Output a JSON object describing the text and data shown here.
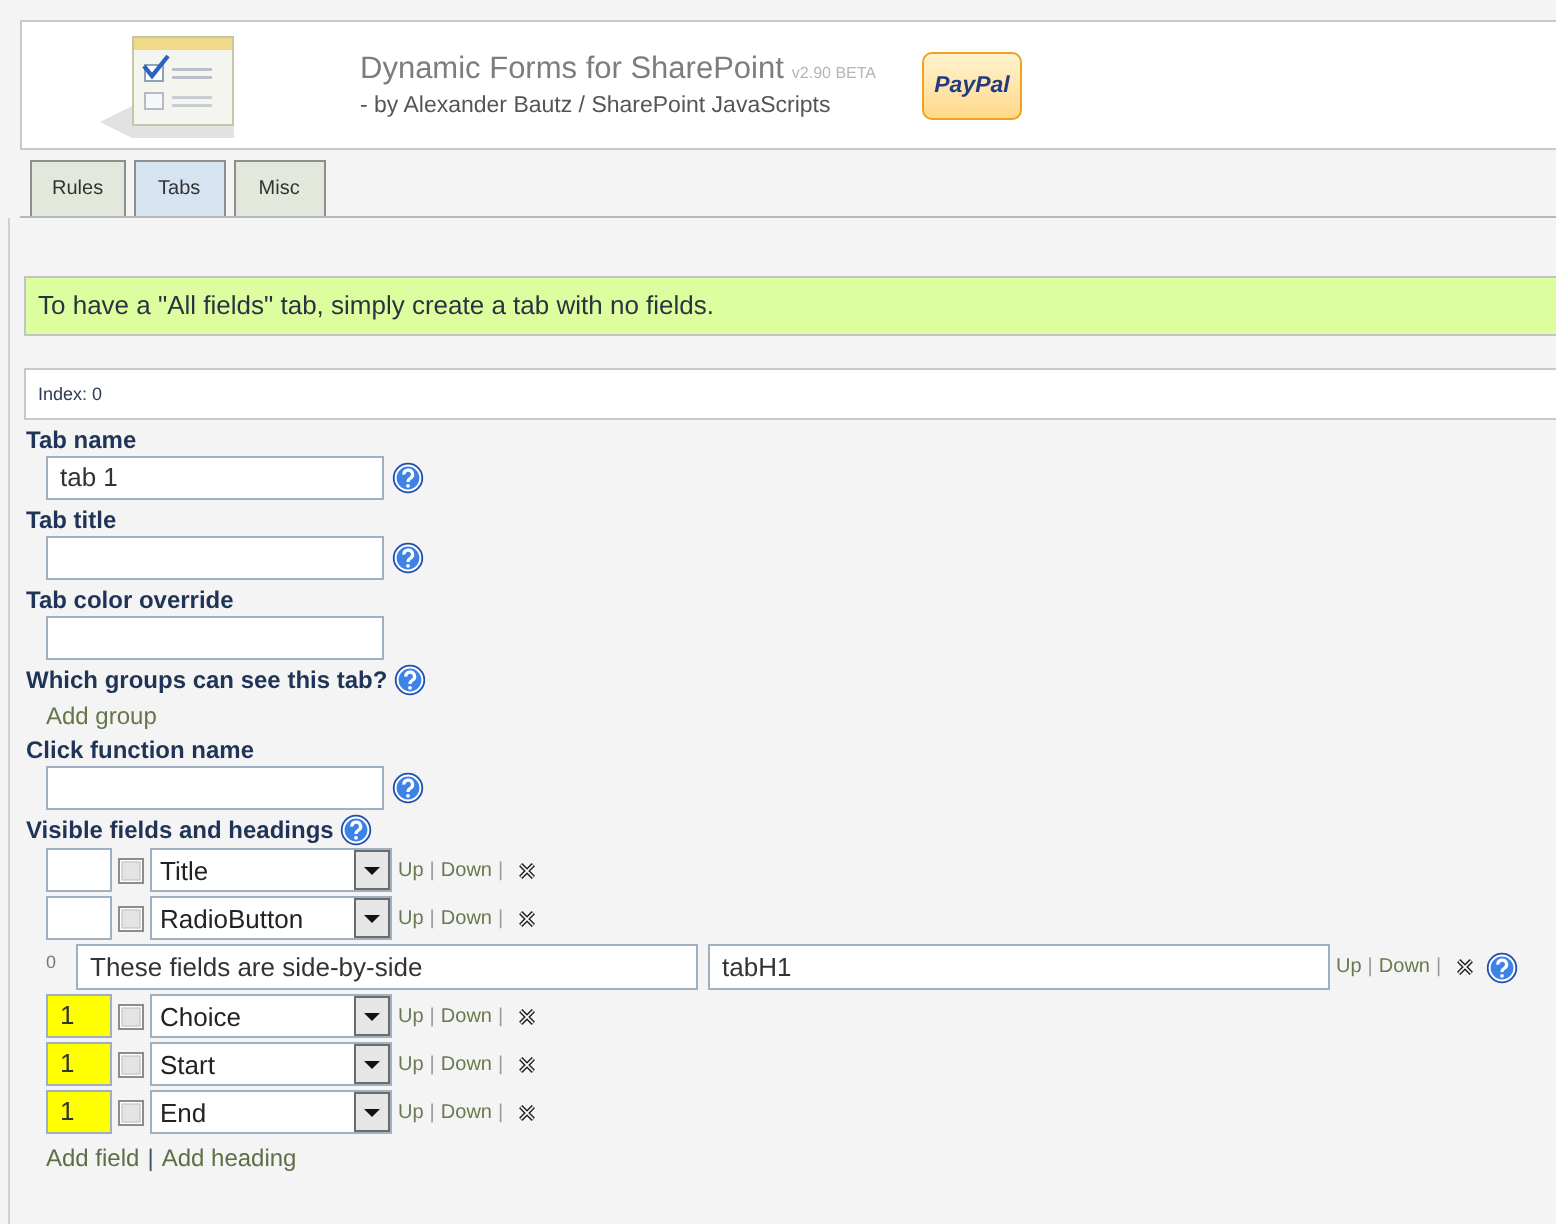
{
  "header": {
    "title": "Dynamic Forms for SharePoint",
    "version": "v2.90 BETA",
    "subtitle": "- by Alexander Bautz / SharePoint JavaScripts",
    "donate_button": "PayPal"
  },
  "tabs": [
    {
      "label": "Rules",
      "selected": false
    },
    {
      "label": "Tabs",
      "selected": true
    },
    {
      "label": "Misc",
      "selected": false
    }
  ],
  "notice": "To have a \"All fields\" tab, simply create a tab with no fields.",
  "index_label": "Index: 0",
  "form_fields": [
    {
      "kind": "input",
      "label": "Tab name",
      "value": "tab 1",
      "help": true
    },
    {
      "kind": "input",
      "label": "Tab title",
      "help": true
    },
    {
      "kind": "input",
      "label": "Tab color override"
    },
    {
      "kind": "link",
      "label": "Which groups can see this tab?",
      "link": "Add group",
      "help": true
    },
    {
      "kind": "input",
      "label": "Click function name",
      "help": true
    }
  ],
  "visible_fields": {
    "label": "Visible fields and headings",
    "help": true,
    "separator": "|",
    "rows": [
      {
        "kind": "field",
        "highlighted": false,
        "checked": false,
        "value": "Title",
        "actions": [
          "Up",
          "Down"
        ]
      },
      {
        "kind": "field",
        "highlighted": false,
        "checked": false,
        "value": "RadioButton",
        "actions": [
          "Up",
          "Down"
        ]
      },
      {
        "kind": "heading",
        "index": "0",
        "text": "These fields are side-by-side",
        "value": "tabH1",
        "actions": [
          "Up",
          "Down"
        ],
        "help": true
      },
      {
        "kind": "field",
        "index": "1",
        "highlighted": true,
        "checked": false,
        "value": "Choice",
        "actions": [
          "Up",
          "Down"
        ]
      },
      {
        "kind": "field",
        "index": "1",
        "highlighted": true,
        "checked": false,
        "value": "Start",
        "actions": [
          "Up",
          "Down"
        ]
      },
      {
        "kind": "field",
        "index": "1",
        "highlighted": true,
        "checked": false,
        "value": "End",
        "actions": [
          "Up",
          "Down"
        ]
      }
    ],
    "links": [
      "Add field",
      "Add heading"
    ]
  }
}
